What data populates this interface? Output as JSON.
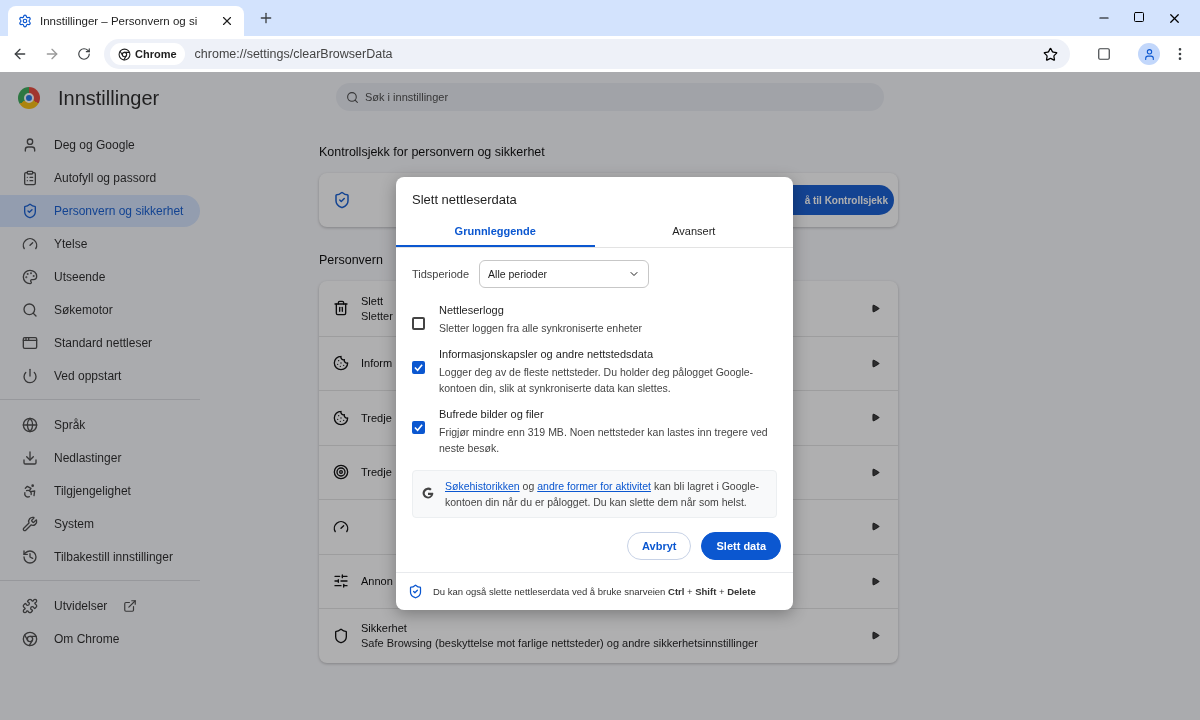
{
  "browser": {
    "tab_title": "Innstillinger – Personvern og si",
    "chip": "Chrome",
    "url": "chrome://settings/clearBrowserData"
  },
  "sidebar": {
    "title": "Innstillinger",
    "sections": [
      {
        "items": [
          {
            "label": "Deg og Google",
            "selected": false
          },
          {
            "label": "Autofyll og passord",
            "selected": false
          },
          {
            "label": "Personvern og sikkerhet",
            "selected": true
          },
          {
            "label": "Ytelse",
            "selected": false
          },
          {
            "label": "Utseende",
            "selected": false
          },
          {
            "label": "Søkemotor",
            "selected": false
          },
          {
            "label": "Standard nettleser",
            "selected": false
          },
          {
            "label": "Ved oppstart",
            "selected": false
          }
        ]
      },
      {
        "items": [
          {
            "label": "Språk",
            "selected": false
          },
          {
            "label": "Nedlastinger",
            "selected": false
          },
          {
            "label": "Tilgjengelighet",
            "selected": false
          },
          {
            "label": "System",
            "selected": false
          },
          {
            "label": "Tilbakestill innstillinger",
            "selected": false
          }
        ]
      },
      {
        "items": [
          {
            "label": "Utvidelser",
            "selected": false,
            "external": true
          },
          {
            "label": "Om Chrome",
            "selected": false
          }
        ]
      }
    ]
  },
  "search": {
    "placeholder": "Søk i innstillinger"
  },
  "safety_check": {
    "heading": "Kontrollsjekk for personvern og sikkerhet",
    "button": "å til Kontrollsjekk"
  },
  "privacy": {
    "heading": "Personvern",
    "rows": [
      {
        "title": "Slett",
        "subtitle": "Sletter"
      },
      {
        "title": "Inform"
      },
      {
        "title": "Tredje"
      },
      {
        "title": "Tredje"
      },
      {},
      {
        "title": "Annon"
      },
      {
        "title": "Sikkerhet",
        "subtitle": "Safe Browsing (beskyttelse mot farlige nettsteder) og andre sikkerhetsinnstillinger"
      }
    ]
  },
  "dialog": {
    "title": "Slett nettleserdata",
    "tabs": [
      {
        "label": "Grunnleggende",
        "selected": true
      },
      {
        "label": "Avansert",
        "selected": false
      }
    ],
    "period_label": "Tidsperiode",
    "period_value": "Alle perioder",
    "options": [
      {
        "title": "Nettleserlogg",
        "description": "Sletter loggen fra alle synkroniserte enheter",
        "checked": false
      },
      {
        "title": "Informasjonskapsler og andre nettstedsdata",
        "description": "Logger deg av de fleste nettsteder. Du holder deg pålogget Google-kontoen din, slik at synkroniserte data kan slettes.",
        "checked": true
      },
      {
        "title": "Bufrede bilder og filer",
        "description": "Frigjør mindre enn 319 MB. Noen nettsteder kan lastes inn tregere ved neste besøk.",
        "checked": true
      }
    ],
    "info": [
      {
        "kind": "link",
        "text": "Søkehistorikken"
      },
      {
        "kind": "text",
        "text": " og "
      },
      {
        "kind": "link",
        "text": "andre former for aktivitet"
      },
      {
        "kind": "text",
        "text": " kan bli lagret i Google-kontoen din når du er pålogget. Du kan slette dem når som helst."
      }
    ],
    "buttons": [
      {
        "label": "Avbryt",
        "kind": "secondary"
      },
      {
        "label": "Slett data",
        "kind": "primary"
      }
    ],
    "footer": "Du kan også slette nettleserdata ved å bruke snarveien **Ctrl** + **Shift** + **Delete**"
  }
}
